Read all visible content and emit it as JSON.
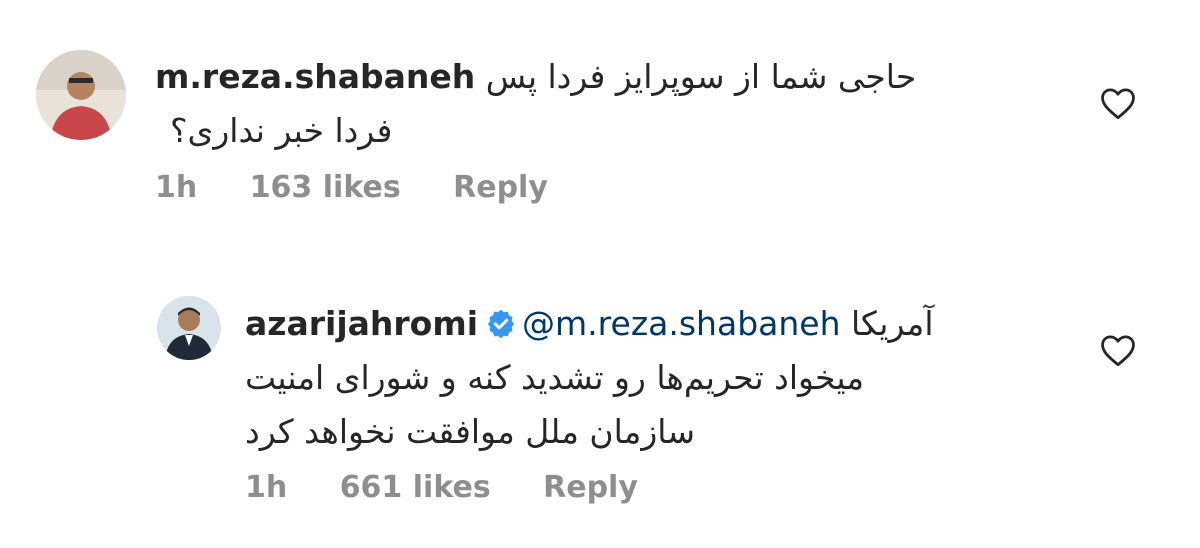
{
  "comments": [
    {
      "username": "m.reza.shabaneh",
      "verified": false,
      "text_line1": "حاجی شما از سوپرایز فردا پس",
      "text_line2": "فردا خبر نداری؟",
      "time": "1h",
      "likes": "163 likes",
      "reply_label": "Reply"
    },
    {
      "username": "azarijahromi",
      "verified": true,
      "mention": "@m.reza.shabaneh",
      "text_line1": "آمریکا",
      "text_line2": "میخواد تحریم‌ها رو تشدید کنه و شورای امنیت",
      "text_line3": "سازمان ملل موافقت نخواهد کرد",
      "time": "1h",
      "likes": "661 likes",
      "reply_label": "Reply"
    }
  ],
  "icons": {
    "like": "heart-outline-icon",
    "verified": "verified-badge-icon"
  },
  "colors": {
    "verified_blue": "#3897f0",
    "meta_gray": "#8e8e8e",
    "mention_blue": "#00376b"
  }
}
